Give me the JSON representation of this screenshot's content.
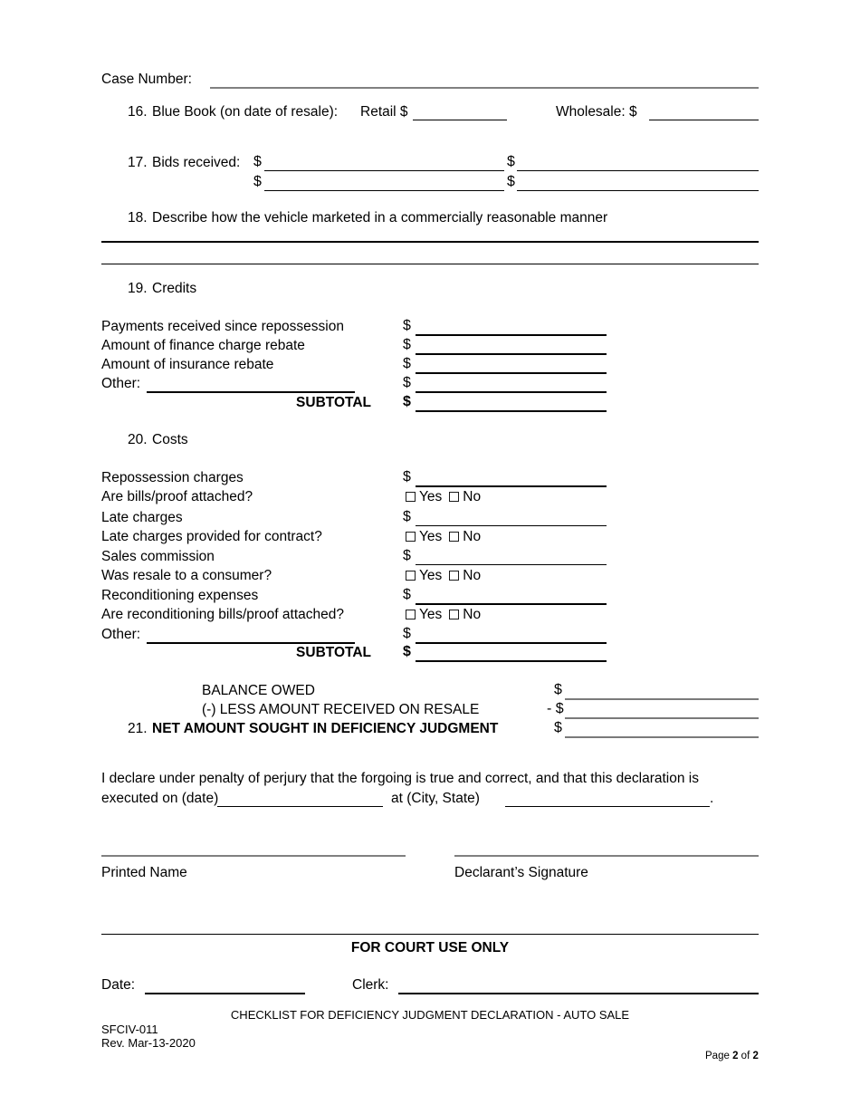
{
  "document": {
    "case_number_label": "Case Number:",
    "footer_title": "CHECKLIST FOR DEFICIENCY JUDGMENT DECLARATION - AUTO SALE",
    "form_code": "SFCIV-011",
    "revision": "Rev. Mar-13-2020",
    "page_prefix": "Page",
    "page_current": "2",
    "page_of": "of",
    "page_total": "2"
  },
  "item16": {
    "number": "16.",
    "label": "Blue Book (on date of resale):",
    "retail_label": "Retail $",
    "wholesale_label": "Wholesale: $"
  },
  "item17": {
    "number": "17.",
    "label": "Bids received:",
    "dollar": "$"
  },
  "item18": {
    "number": "18.",
    "label": "Describe how the vehicle marketed in a commercially reasonable manner"
  },
  "item19": {
    "number": "19.",
    "label": "Credits",
    "rows": [
      {
        "label": "Payments received since repossession",
        "type": "amount",
        "dollar": "$"
      },
      {
        "label": "Amount of finance charge rebate",
        "type": "amount",
        "dollar": "$"
      },
      {
        "label": "Amount of insurance rebate",
        "type": "amount",
        "dollar": "$"
      },
      {
        "label": "Other:",
        "type": "amount-other",
        "dollar": "$"
      }
    ],
    "subtotal_label": "SUBTOTAL",
    "subtotal_dollar": "$"
  },
  "item20": {
    "number": "20.",
    "label": "Costs",
    "rows": [
      {
        "label": "Repossession charges",
        "type": "amount",
        "dollar": "$"
      },
      {
        "label": "Are bills/proof attached?",
        "type": "yesno"
      },
      {
        "label": "Late charges",
        "type": "amount",
        "dollar": "$"
      },
      {
        "label": "Late charges provided for contract?",
        "type": "yesno"
      },
      {
        "label": "Sales commission",
        "type": "amount",
        "dollar": "$"
      },
      {
        "label": "Was resale to a consumer?",
        "type": "yesno"
      },
      {
        "label": "Reconditioning expenses",
        "type": "amount",
        "dollar": "$"
      },
      {
        "label": "Are reconditioning bills/proof attached?",
        "type": "yesno"
      },
      {
        "label": "Other:",
        "type": "amount-other",
        "dollar": "$"
      }
    ],
    "yes_label": "Yes",
    "no_label": "No",
    "subtotal_label": "SUBTOTAL",
    "subtotal_dollar": "$"
  },
  "totals": {
    "balance_owed_label": "BALANCE OWED",
    "balance_owed_dollar": "$",
    "less_amount_label": "(-) LESS AMOUNT RECEIVED ON RESALE",
    "less_amount_dollar": "- $",
    "net_number": "21.",
    "net_label": "NET AMOUNT SOUGHT IN DEFICIENCY JUDGMENT",
    "net_dollar": "$"
  },
  "declaration": {
    "line1": "I declare under penalty of perjury that the forgoing is true and correct, and that this declaration is",
    "line2_a": "executed on (date)",
    "line2_b": "at (City, State)",
    "line2_c": ".",
    "printed_name_label": "Printed Name",
    "signature_label": "Declarant’s Signature"
  },
  "court_use": {
    "heading": "FOR COURT USE ONLY",
    "date_label": "Date:",
    "clerk_label": "Clerk:"
  }
}
